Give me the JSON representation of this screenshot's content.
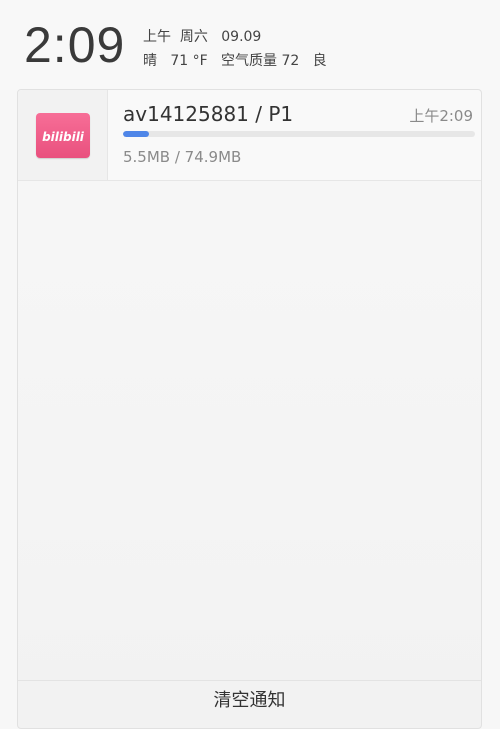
{
  "status": {
    "time": "2:09",
    "date_line": "上午  周六   09.09",
    "weather_line": "晴   71 °F   空气质量 72   良"
  },
  "notification": {
    "app_icon": "bilibili-icon",
    "app_icon_text": "bilibili",
    "title": "av14125881 / P1",
    "time": "上午2:09",
    "size_text": "5.5MB / 74.9MB",
    "progress_fraction": 0.073,
    "progress_color": "#4f86e8",
    "icon_color": "#f06a93"
  },
  "footer": {
    "clear_label": "清空通知"
  }
}
